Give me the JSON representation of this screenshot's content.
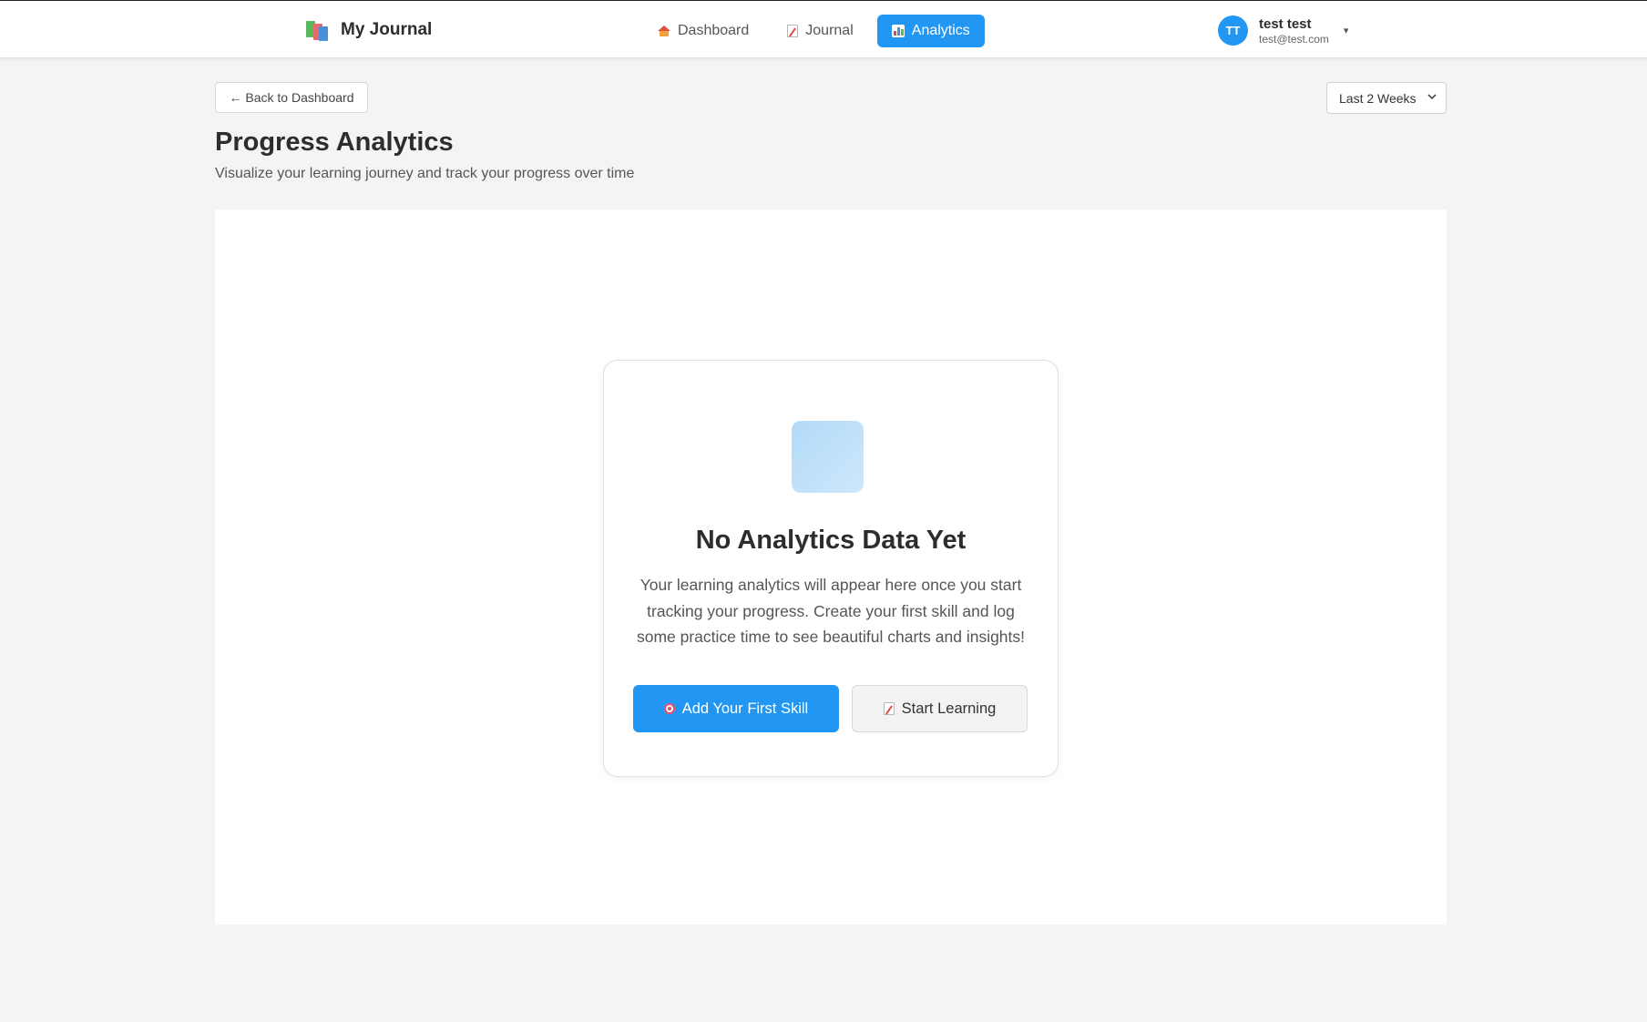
{
  "header": {
    "app_title": "My Journal",
    "nav": [
      {
        "label": "Dashboard",
        "icon": "house-icon",
        "active": false
      },
      {
        "label": "Journal",
        "icon": "memo-icon",
        "active": false
      },
      {
        "label": "Analytics",
        "icon": "bar-chart-icon",
        "active": true
      }
    ],
    "user": {
      "initials": "TT",
      "name": "test test",
      "email": "test@test.com",
      "caret": "▾"
    }
  },
  "toolbar": {
    "back_label": "← Back to Dashboard",
    "range_selected": "Last 2 Weeks"
  },
  "page": {
    "title": "Progress Analytics",
    "subtitle": "Visualize your learning journey and track your progress over time"
  },
  "empty_state": {
    "title": "No Analytics Data Yet",
    "message": "Your learning analytics will appear here once you start tracking your progress. Create your first skill and log some practice time to see beautiful charts and insights!",
    "primary_label": "Add Your First Skill",
    "secondary_label": "Start Learning"
  },
  "colors": {
    "accent": "#2196f3",
    "background": "#f4f4f4",
    "card": "#ffffff"
  }
}
